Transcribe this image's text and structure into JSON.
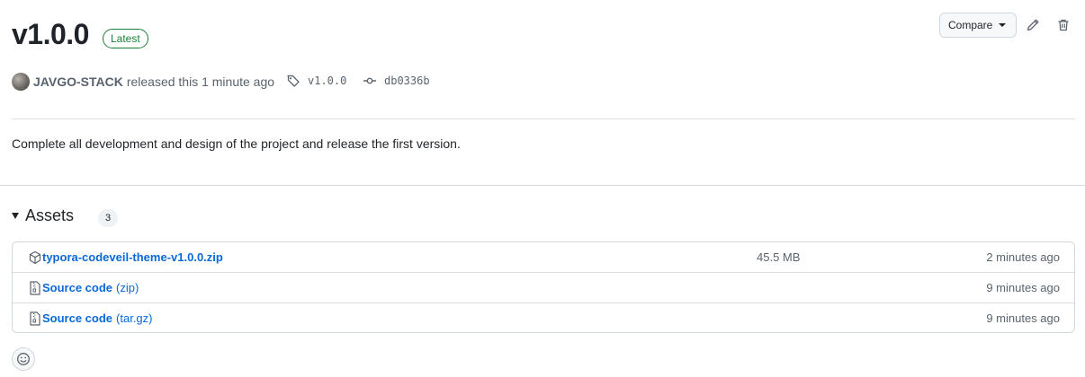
{
  "release": {
    "title": "v1.0.0",
    "badge": "Latest",
    "author": "JAVGO-STACK",
    "released_text": "released this 1 minute ago",
    "tag": "v1.0.0",
    "commit": "db0336b",
    "description": "Complete all development and design of the project and release the first version."
  },
  "toolbar": {
    "compare_label": "Compare"
  },
  "assets": {
    "title": "Assets",
    "count": "3",
    "items": [
      {
        "name": "typora-codeveil-theme-v1.0.0.zip",
        "sub": "",
        "size": "45.5 MB",
        "time": "2 minutes ago",
        "icon": "package-icon"
      },
      {
        "name": "Source code",
        "sub": "(zip)",
        "size": "",
        "time": "9 minutes ago",
        "icon": "file-zip-icon"
      },
      {
        "name": "Source code",
        "sub": "(tar.gz)",
        "size": "",
        "time": "9 minutes ago",
        "icon": "file-zip-icon"
      }
    ]
  },
  "colors": {
    "link": "#0969da",
    "latest": "#1a7f37",
    "muted": "#59636e",
    "border": "#d0d7de"
  }
}
